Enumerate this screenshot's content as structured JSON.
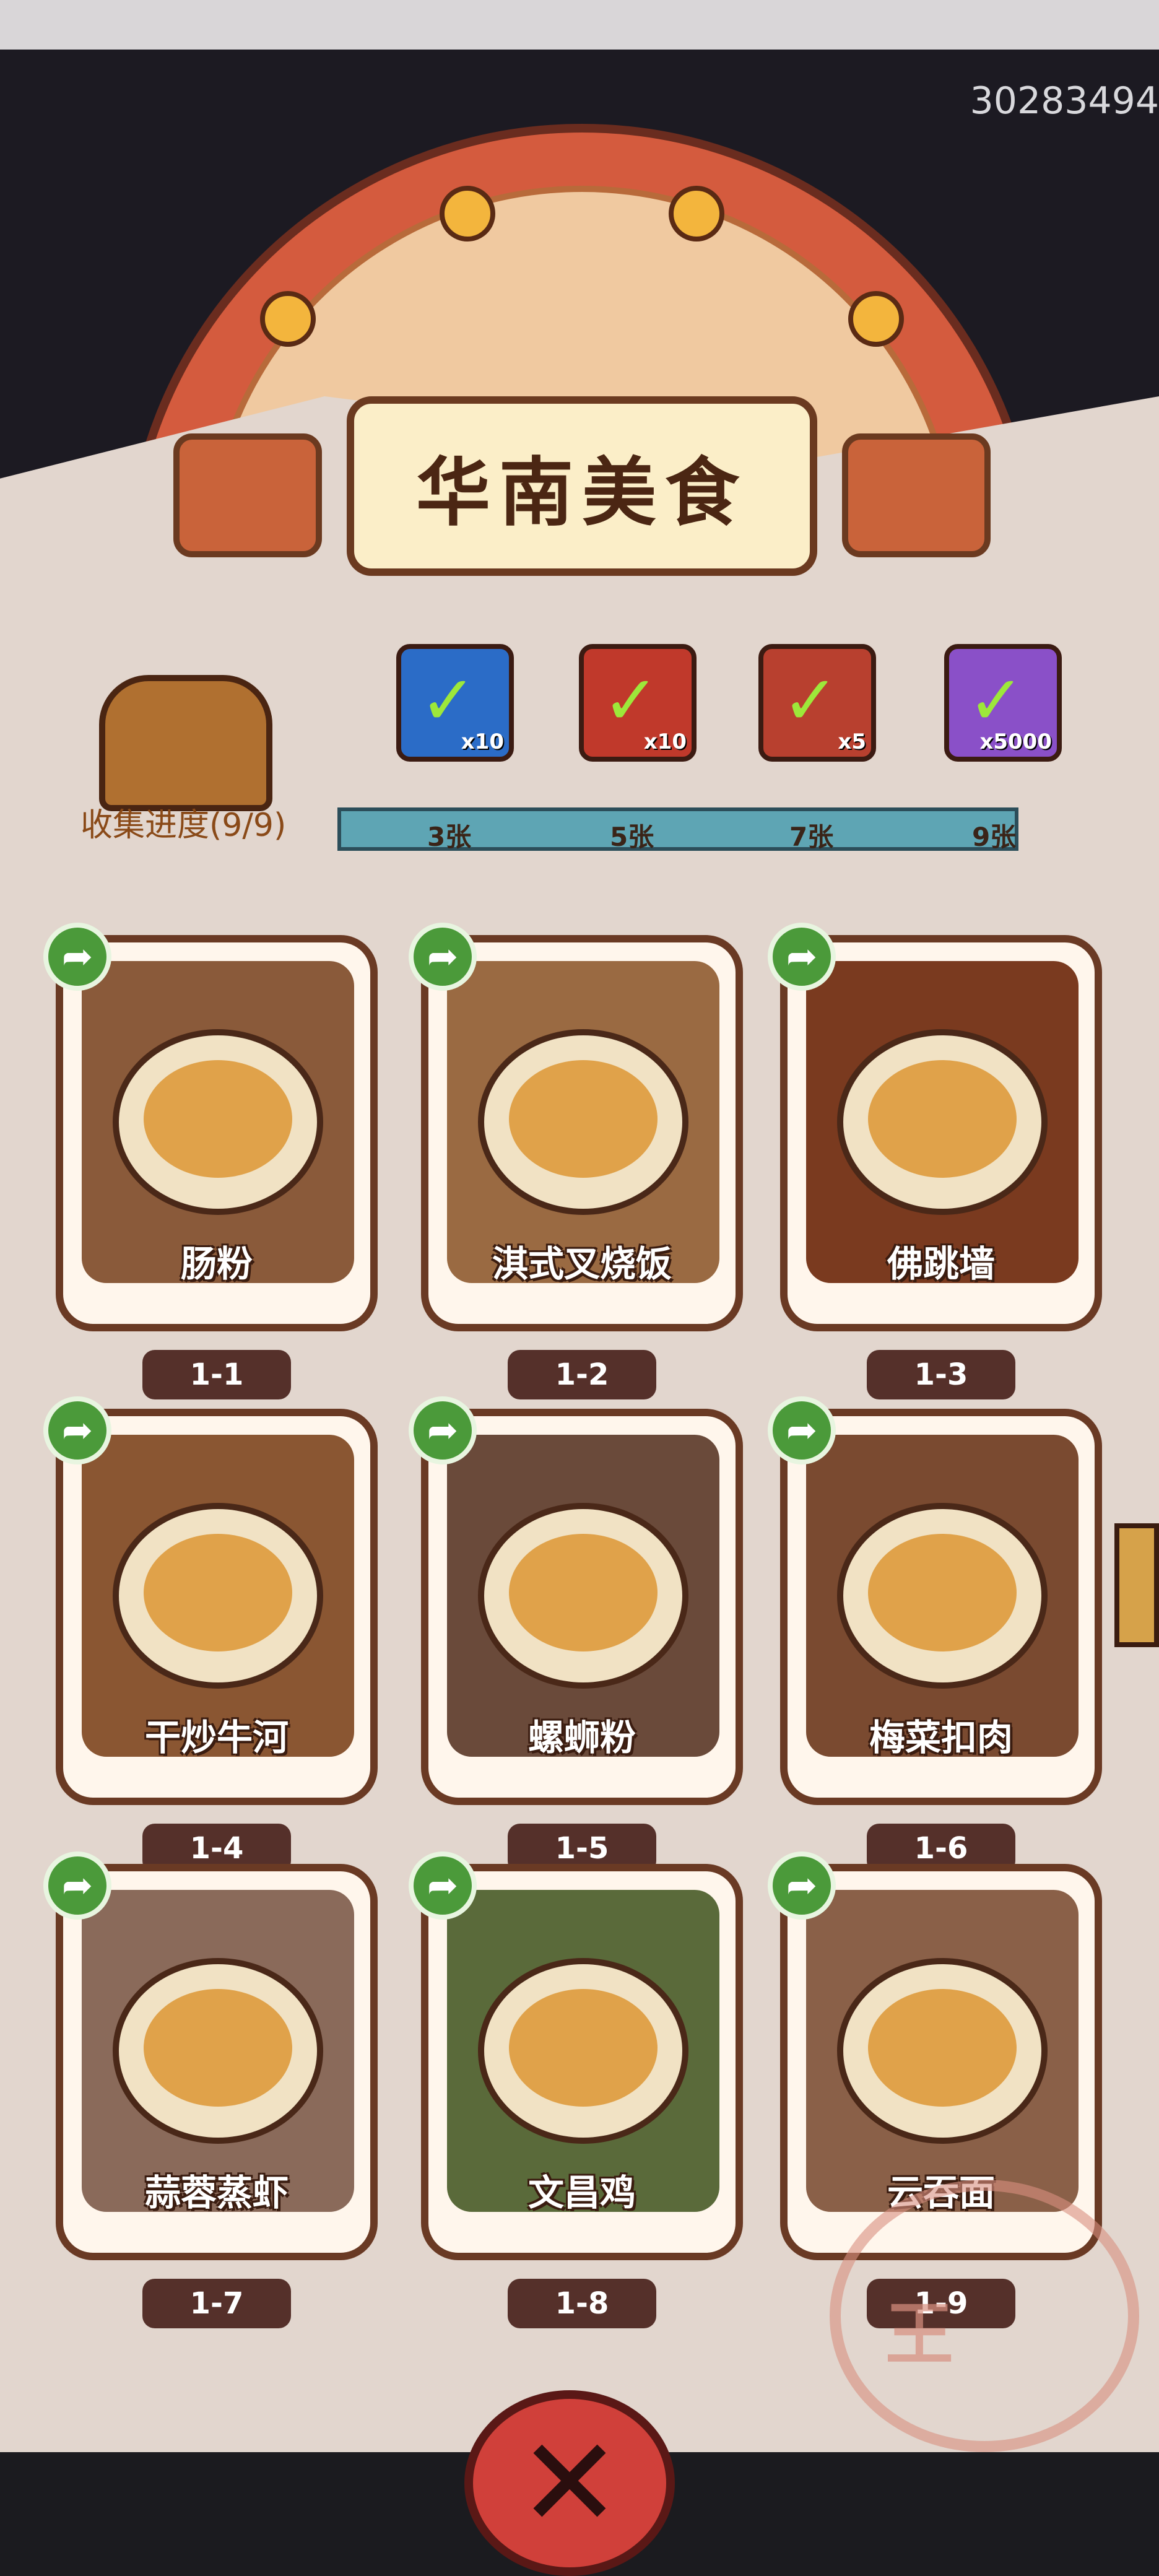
{
  "header": {
    "id_text": "30283494"
  },
  "title": "华南美食",
  "progress": {
    "label": "收集进度(9/9)",
    "collected": 9,
    "total": 9
  },
  "rewards": [
    {
      "icon": "meat-icon",
      "qty": "x10",
      "claimed": true,
      "color": "#2b6cc7"
    },
    {
      "icon": "scroll-icon",
      "qty": "x10",
      "claimed": true,
      "color": "#c0392b"
    },
    {
      "icon": "orb-icon",
      "qty": "x5",
      "claimed": true,
      "color": "#b8402f"
    },
    {
      "icon": "card-icon",
      "qty": "x5000",
      "claimed": true,
      "color": "#8a50c8"
    }
  ],
  "milestones": [
    "3张",
    "5张",
    "7张",
    "9张"
  ],
  "dishes": [
    {
      "name": "肠粉",
      "code": "1-1",
      "color": "#8a5a3a"
    },
    {
      "name": "淇式叉烧饭",
      "code": "1-2",
      "color": "#9a6a42"
    },
    {
      "name": "佛跳墙",
      "code": "1-3",
      "color": "#7a3a1f"
    },
    {
      "name": "干炒牛河",
      "code": "1-4",
      "color": "#8a5632"
    },
    {
      "name": "螺蛳粉",
      "code": "1-5",
      "color": "#6a4a3a"
    },
    {
      "name": "梅菜扣肉",
      "code": "1-6",
      "color": "#7a4a30"
    },
    {
      "name": "蒜蓉蒸虾",
      "code": "1-7",
      "color": "#8a6a5a"
    },
    {
      "name": "文昌鸡",
      "code": "1-8",
      "color": "#5a6a3a"
    },
    {
      "name": "云吞面",
      "code": "1-9",
      "color": "#8a6048"
    }
  ],
  "seal_text": "王"
}
